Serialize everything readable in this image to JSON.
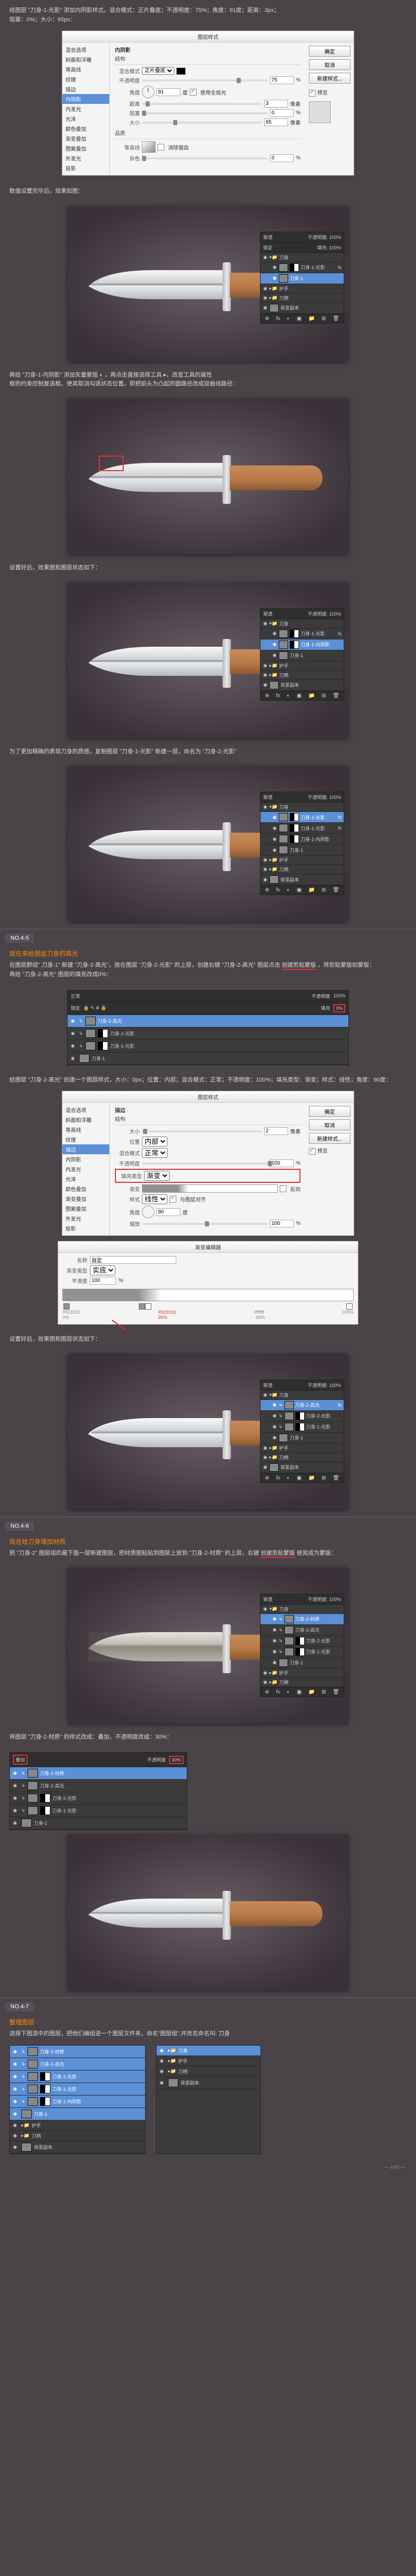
{
  "step1": {
    "intro": "给图层 \"刀身-1-光影\" 添加内阴影样式。混合模式：正片叠底；不透明度：75%；角度：91度；距离：3px；",
    "intro2": "阻塞：0%；大小：65px："
  },
  "layer_style": {
    "title": "图层样式",
    "left": [
      "混合选项",
      "斜面和浮雕",
      "等高线",
      "纹理",
      "描边",
      "内阴影",
      "内发光",
      "光泽",
      "颜色叠加",
      "渐变叠加",
      "图案叠加",
      "外发光",
      "投影"
    ],
    "selected": "内阴影",
    "section1": "结构",
    "blend_label": "混合模式",
    "blend": "正片叠底",
    "opacity_label": "不透明度",
    "opacity": "75",
    "pct": "%",
    "angle_label": "角度",
    "angle": "91",
    "deg": "度",
    "global": "使用全局光",
    "distance_label": "距离",
    "distance": "3",
    "px": "像素",
    "choke_label": "阻塞",
    "choke": "0",
    "size_label": "大小",
    "size": "65",
    "section2": "品质",
    "contour_label": "等高线",
    "antialias": "消除锯齿",
    "noise_label": "杂色",
    "noise": "0",
    "btn_ok": "确定",
    "btn_cancel": "取消",
    "btn_new": "新建样式...",
    "btn_preview": "预览"
  },
  "caption_after": "数值设置完毕后，效果如图：",
  "step2": {
    "text": "再给 \"刀身-1-内阴影\" 添加矢量蒙版",
    "note": "，再点击直接选择工具 ▸，改变工具的属性",
    "text2": "框的约束控制复选框。使其取消勾选状态位置。即把前头为凸起的圆路径改成双曲线路径："
  },
  "caption_done": "设置好后，效果图和图层状态如下：",
  "step3": "为了更加精确的表现刀身的质感，复制图层 \"刀身-1-光影\" 新建一层，命名为 \"刀身-2-光影\"",
  "section45": {
    "tag": "NO.4-5",
    "heading": "现在来给图层刀身的高光",
    "t1": "在图层群组\" 刀身-1\" 新建 \"刀身-2-高光\"，放在图层 \"刀身-2-光影\" 的上层，创建右键 \"刀身-2-高光\" 图层点击",
    "t1b": "创建剪贴蒙版",
    "t1c": "，将剪贴蒙版如蒙版：",
    "t2": "再给 \"刀身-2-高光\" 图层的填充改成0%："
  },
  "layers_strip1": {
    "opts_mode": "正常",
    "opts_opacity": "不透明度",
    "opts_opv": "100%",
    "opts_fill": "填充",
    "opts_fillv": "0%",
    "rows": [
      {
        "name": "刀身-2-高光",
        "sel": true
      },
      {
        "name": "刀身-2-光影"
      },
      {
        "name": "刀身-1-光影"
      },
      {
        "name": "刀身-1"
      }
    ]
  },
  "step_gradstyle": "给图层 \"刀身-2-高光\" 创建一个图层样式，大小：0px；位置：内部；混合模式：正常；不透明度：100%；填充类型：渐变；样式：线性；角度：90度：",
  "layer_style2": {
    "title": "图层样式",
    "selected": "描边",
    "section1": "结构",
    "size_label": "大小",
    "size": "2",
    "px": "像素",
    "pos_label": "位置",
    "pos": "内部",
    "blend_label": "混合模式",
    "blend": "正常",
    "opacity_label": "不透明度",
    "opacity": "100",
    "pct": "%",
    "section2": "填充类型",
    "filltype": "渐变",
    "grad_label": "渐变",
    "reverse": "反向",
    "style_label": "样式",
    "style": "线性",
    "align": "与图层对齐",
    "angle_label": "角度",
    "angle": "90",
    "deg": "度",
    "scale_label": "缩放",
    "scale": "100"
  },
  "grad_editor": {
    "title": "渐变编辑器",
    "name_label": "名称",
    "name": "自定",
    "type_label": "渐变类型",
    "type": "实底",
    "smooth_label": "平滑度",
    "smooth": "100",
    "pct": "%",
    "stops": [
      {
        "hex": "#919191",
        "pos": "0%"
      },
      {
        "hex": "#919191",
        "pos": "26%"
      },
      {
        "hex": "#ffffff",
        "pos": "34%"
      },
      {
        "hex": "#ffffff",
        "pos": "100%"
      }
    ],
    "arrow_note": "第二色标位置"
  },
  "caption_grad_done": "设置好后，效果图和图层状态如下：",
  "section46": {
    "tag": "NO.4-6",
    "heading": "现在给刀身增加材质",
    "t1": "把 \"刀身-2\" 图层组的最下面一层新建图层，把材质图粘贴到图层上放到 \"刀身-2-材质\" 的上层，右键",
    "t1b": "创建剪贴蒙版",
    "t1c": "使其成为蒙版："
  },
  "step_blend": "将图层 \"刀身-2-材质\" 的样式改成：叠加，不透明度改成：30%：",
  "layers_strip2": {
    "opts_mode": "叠加",
    "opts_opv": "30%",
    "rows": [
      {
        "name": "刀身-2-材质",
        "sel": true,
        "red": true
      },
      {
        "name": "刀身-2-高光"
      },
      {
        "name": "刀身-2-光影"
      },
      {
        "name": "刀身-1-光影"
      },
      {
        "name": "刀身-1"
      }
    ]
  },
  "section47": {
    "tag": "NO.4-7",
    "heading": "整理图层",
    "t1": "选择下图选中的图层，把他们编组进一个图层文件夹，命名\"图层组\",并改名命名叫: 刀身"
  },
  "final_layers": {
    "rows": [
      {
        "name": "刀身-2-材质"
      },
      {
        "name": "刀身-2-高光"
      },
      {
        "name": "刀身-2-光影"
      },
      {
        "name": "刀身-1-光影"
      },
      {
        "name": "刀身-1-内阴影"
      },
      {
        "name": "刀身-1"
      },
      {
        "name": "护手"
      },
      {
        "name": "刀柄"
      },
      {
        "name": "背景副本"
      }
    ],
    "group": "刀身"
  },
  "layers_labels": {
    "eye": "◉",
    "fx": "fx",
    "mode": "穿透",
    "opacity": "不透明度: 100%",
    "lock": "锁定",
    "fill": "填充: 100%",
    "k_body": "刀身",
    "k_guard": "护手",
    "k_handle": "刀柄",
    "k_bg": "背景副本",
    "ly1": "刀身-1",
    "ly1s": "刀身-1-光影",
    "ly2s": "刀身-2-光影",
    "ly2h": "刀身-2-高光",
    "ly2t": "刀身-2-材质",
    "ly1is": "刀身-1-内阴影"
  }
}
